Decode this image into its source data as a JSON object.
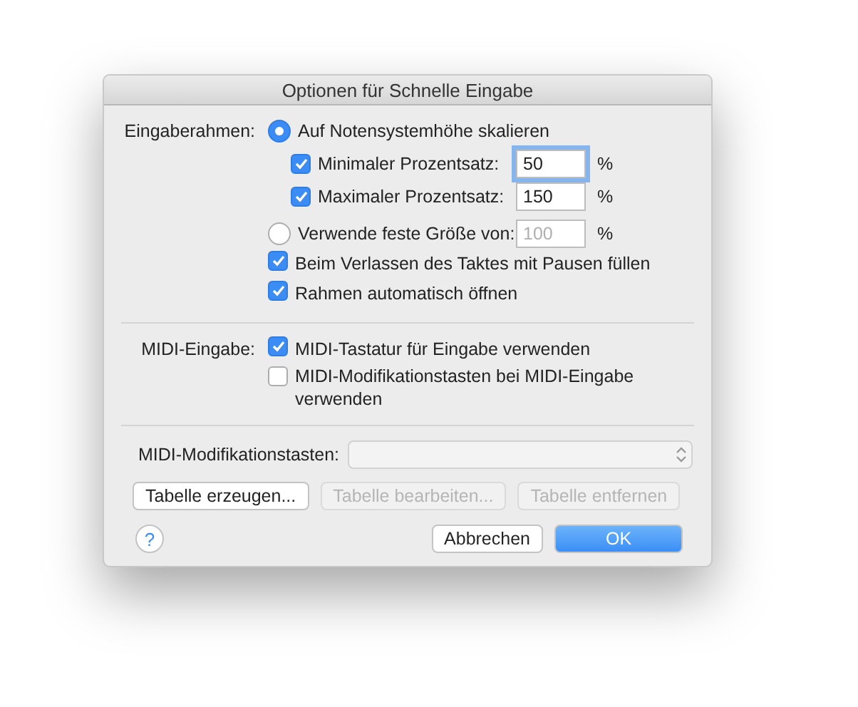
{
  "window": {
    "title": "Optionen für Schnelle Eingabe"
  },
  "sections": [
    {
      "label": "Eingaberahmen:",
      "rows": [
        {
          "kind": "radio",
          "label": "Auf Notensystemhöhe skalieren",
          "selected": true,
          "children": [
            {
              "kind": "percent",
              "label": "Minimaler Prozentsatz:",
              "checked": true,
              "value": "50",
              "unit": "%",
              "focused": true,
              "disabled": false
            },
            {
              "kind": "percent",
              "label": "Maximaler Prozentsatz:",
              "checked": true,
              "value": "150",
              "unit": "%",
              "focused": false,
              "disabled": false
            }
          ]
        },
        {
          "kind": "radio",
          "label": "Verwende feste Größe von:",
          "selected": false,
          "value": "100",
          "unit": "%",
          "disabled": true
        },
        {
          "kind": "checkbox",
          "label": "Beim Verlassen des Taktes mit Pausen füllen",
          "checked": true
        },
        {
          "kind": "checkbox",
          "label": "Rahmen automatisch öffnen",
          "checked": true
        }
      ]
    },
    {
      "label": "MIDI-Eingabe:",
      "rows": [
        {
          "kind": "checkbox",
          "label": "MIDI-Tastatur für Eingabe verwenden",
          "checked": true
        },
        {
          "kind": "checkbox",
          "label": "MIDI-Modifikationstasten bei MIDI-Eingabe verwenden",
          "checked": false
        }
      ]
    }
  ],
  "popup": {
    "label": "MIDI-Modifikationstasten:",
    "disabled": true
  },
  "table_buttons": [
    {
      "label": "Tabelle erzeugen...",
      "disabled": false
    },
    {
      "label": "Tabelle bearbeiten...",
      "disabled": true
    },
    {
      "label": "Tabelle entfernen",
      "disabled": true
    }
  ],
  "help": {
    "label": "?"
  },
  "actions": [
    {
      "label": "Abbrechen",
      "default": false
    },
    {
      "label": "OK",
      "default": true
    }
  ]
}
